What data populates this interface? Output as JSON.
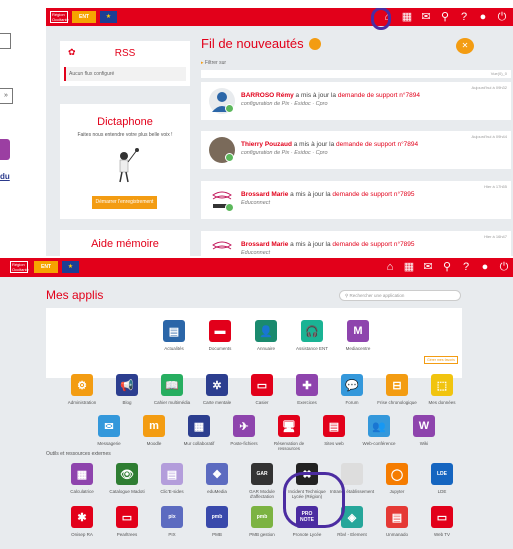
{
  "left_fragment": {
    "chevron": "»",
    "link_text": "du"
  },
  "top": {
    "header": {
      "logo_small": "Région Occitanie",
      "logo_ent": "ENT",
      "logo_eu": "★"
    },
    "rss": {
      "title": "RSS",
      "notice": "Aucun flux configuré"
    },
    "dictaphone": {
      "title": "Dictaphone",
      "subtitle": "Faites nous entendre votre plus belle voix !",
      "button": "Démarrer l'enregistrement"
    },
    "aide": {
      "title": "Aide mémoire"
    },
    "feed": {
      "title": "Fil de nouveautés",
      "filter": "Filtrer sur",
      "top_link": "Vue(0)_0",
      "items": [
        {
          "name": "BARROSO Rémy",
          "action": "a mis à jour la",
          "link": "demande de support n°7894",
          "context": "configuration de Pix · Esidoc · Cpro",
          "when": "Aujourd'hui à 09h32"
        },
        {
          "name": "Thierry Pouzaud",
          "action": "a mis à jour la",
          "link": "demande de support n°7894",
          "context": "configuration de Pix · Esidoc · Cpro",
          "when": "Aujourd'hui à 09h44"
        },
        {
          "name": "Brossard Marie",
          "action": "a mis à jour la",
          "link": "demande de support n°7895",
          "context": "Educonnect",
          "when": "Hier à 17h55"
        },
        {
          "name": "Brossard Marie",
          "action": "a mis à jour la",
          "link": "demande de support n°7895",
          "context": "Educonnect",
          "when": "Hier à 16h47"
        }
      ]
    }
  },
  "bottom": {
    "title": "Mes applis",
    "search_placeholder": "Rechercher une application",
    "fav_button": "Gérer mes favoris",
    "section_external": "Outils et ressources externes",
    "favorites": [
      {
        "label": "Actualités",
        "color": "#2b66a8",
        "glyph": "▤"
      },
      {
        "label": "Documents",
        "color": "#e2001a",
        "glyph": "▬"
      },
      {
        "label": "Annuaire",
        "color": "#1a8a6e",
        "glyph": "👤"
      },
      {
        "label": "Assistance ENT",
        "color": "#1ab394",
        "glyph": "🎧"
      },
      {
        "label": "Mediacentre",
        "color": "#8e44ad",
        "glyph": "M"
      }
    ],
    "apps_row1": [
      {
        "label": "Administration",
        "color": "#f39c12",
        "glyph": "⚙"
      },
      {
        "label": "Blog",
        "color": "#2c3e8f",
        "glyph": "📢"
      },
      {
        "label": "Cahier multimédia",
        "color": "#27ae60",
        "glyph": "📖"
      },
      {
        "label": "Carte mentale",
        "color": "#2c3e8f",
        "glyph": "✲"
      },
      {
        "label": "Casier",
        "color": "#e2001a",
        "glyph": "▭"
      },
      {
        "label": "Exercices",
        "color": "#8e44ad",
        "glyph": "✚"
      },
      {
        "label": "Forum",
        "color": "#3498db",
        "glyph": "💬"
      },
      {
        "label": "Frise chronologique",
        "color": "#f39c12",
        "glyph": "⊟"
      },
      {
        "label": "Mes données",
        "color": "#f1c40f",
        "glyph": "⬚"
      }
    ],
    "apps_row2": [
      {
        "label": "Messagerie",
        "color": "#3498db",
        "glyph": "✉"
      },
      {
        "label": "Moodle",
        "color": "#f39c12",
        "glyph": "m"
      },
      {
        "label": "Mur collaboratif",
        "color": "#2c3e8f",
        "glyph": "▦"
      },
      {
        "label": "Poste-fichiers",
        "color": "#8e44ad",
        "glyph": "✈"
      },
      {
        "label": "Réservation de ressources",
        "color": "#e2001a",
        "glyph": "🖥"
      },
      {
        "label": "Sites web",
        "color": "#e2001a",
        "glyph": "▤"
      },
      {
        "label": "Web-conférence",
        "color": "#3498db",
        "glyph": "👥"
      },
      {
        "label": "Wiki",
        "color": "#8e44ad",
        "glyph": "W"
      }
    ],
    "apps_row3": [
      {
        "label": "Calculatrice",
        "color": "#8e44ad",
        "glyph": "▦"
      },
      {
        "label": "Catalogue Madoti",
        "color": "#2e7d32",
        "glyph": "👁"
      },
      {
        "label": "Clic'E-sides",
        "color": "#b39ddb",
        "glyph": "▤"
      },
      {
        "label": "eduMedia",
        "color": "#5c6bc0",
        "glyph": "❖"
      },
      {
        "label": "GAR Module d'affectation",
        "color": "#333333",
        "glyph": "GAR"
      },
      {
        "label": "Incident Technique Lycée (Région)",
        "color": "#222222",
        "glyph": "✖"
      },
      {
        "label": "Intranet établissement",
        "color": "#dddddd",
        "glyph": " "
      },
      {
        "label": "Jupyter",
        "color": "#f57c00",
        "glyph": "◯"
      },
      {
        "label": "LDE",
        "color": "#1565c0",
        "glyph": "LDE"
      }
    ],
    "apps_row4": [
      {
        "label": "Onisep RA",
        "color": "#e2001a",
        "glyph": "✱"
      },
      {
        "label": "Pearltrees",
        "color": "#e2001a",
        "glyph": "▭"
      },
      {
        "label": "PIX",
        "color": "#5c6bc0",
        "glyph": "pix"
      },
      {
        "label": "PMB",
        "color": "#3949ab",
        "glyph": "pmb"
      },
      {
        "label": "PMB gestion",
        "color": "#7cb342",
        "glyph": "pmb"
      },
      {
        "label": "Pronote Lycée",
        "color": "#4b2ca1",
        "glyph": "PRO NOTE"
      },
      {
        "label": "Rbvl - Element",
        "color": "#26a69a",
        "glyph": "◈"
      },
      {
        "label": "Unmanado",
        "color": "#e53935",
        "glyph": "▤"
      },
      {
        "label": "Web TV",
        "color": "#e2001a",
        "glyph": "▭"
      }
    ]
  }
}
